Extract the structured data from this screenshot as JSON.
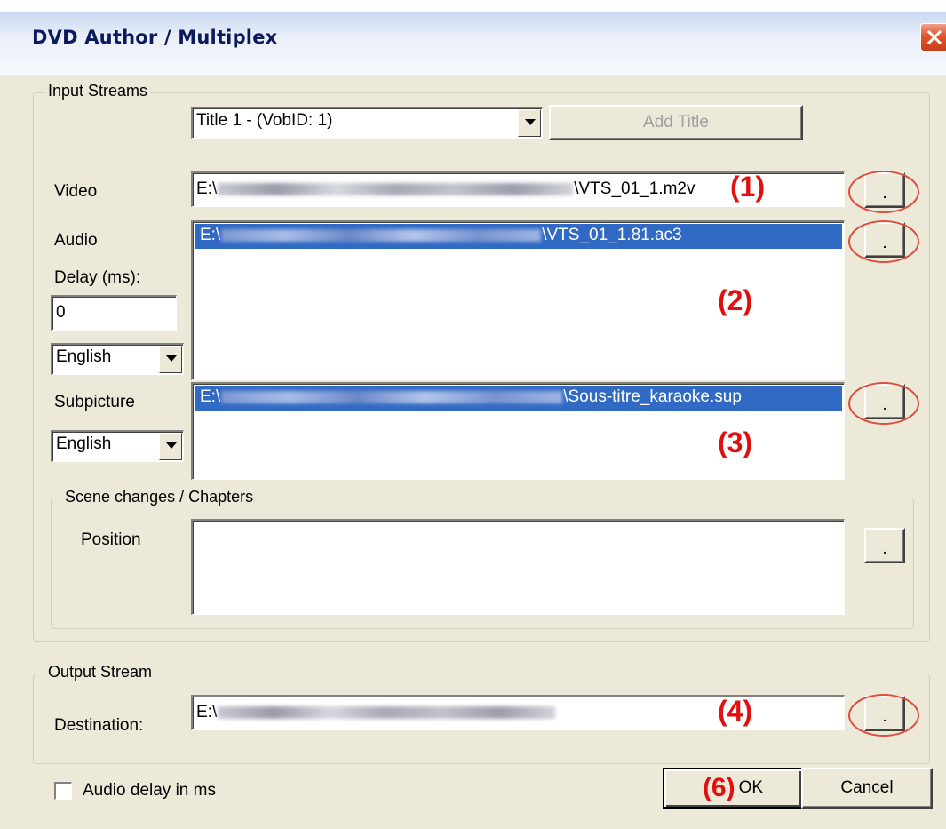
{
  "window": {
    "title": "DVD Author / Multiplex"
  },
  "input_streams": {
    "group_title": "Input Streams",
    "title_select": {
      "value": "Title 1 - (VobID: 1)"
    },
    "add_title_label": "Add Title",
    "video": {
      "label": "Video",
      "path_prefix": "E:\\",
      "path_suffix": "\\VTS_01_1.m2v",
      "browse_label": ".",
      "annotation": "(1)"
    },
    "audio": {
      "label": "Audio",
      "item_prefix": "E:\\",
      "item_suffix": "\\VTS_01_1.81.ac3",
      "browse_label": ".",
      "annotation": "(2)",
      "delay_label": "Delay (ms):",
      "delay_value": "0",
      "language": "English"
    },
    "subpicture": {
      "label": "Subpicture",
      "item_prefix": "E:\\",
      "item_suffix": "\\Sous-titre_karaoke.sup",
      "browse_label": ".",
      "annotation": "(3)",
      "language": "English"
    },
    "chapters": {
      "group_title": "Scene changes / Chapters",
      "position_label": "Position",
      "browse_label": "."
    }
  },
  "output_stream": {
    "group_title": "Output Stream",
    "destination_label": "Destination:",
    "path_prefix": "E:\\",
    "browse_label": ".",
    "annotation": "(4)"
  },
  "footer": {
    "audio_delay_checkbox_label": "Audio delay in ms",
    "audio_delay_checked": false,
    "ok_label": "OK",
    "ok_annotation": "(6)",
    "cancel_label": "Cancel"
  },
  "colors": {
    "dialog_bg": "#ece9d8",
    "selection": "#316ac5",
    "annotation": "#e01010",
    "close_button": "#e0562d"
  }
}
